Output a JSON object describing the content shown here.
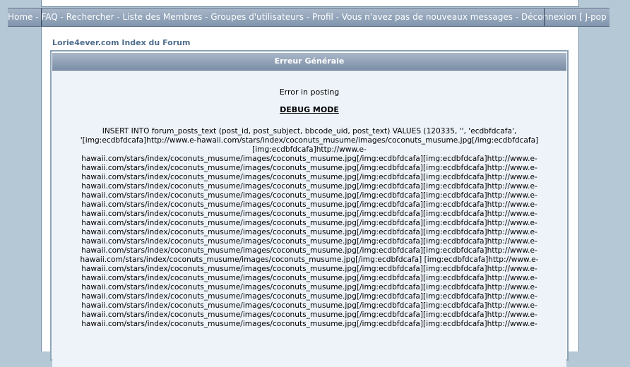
{
  "nav": {
    "items": [
      "Home",
      "FAQ",
      "Rechercher",
      "Liste des Membres",
      "Groupes d'utilisateurs",
      "Profil",
      "Vous n'avez pas de nouveaux messages",
      "Déconnexion [ J-pop idol ]"
    ],
    "separator": "-"
  },
  "forum_index_link": "Lorie4ever.com Index du Forum",
  "error": {
    "title": "Erreur Générale",
    "message": "Error in posting",
    "debug_label": "DEBUG MODE",
    "sql_lines": [
      "INSERT INTO forum_posts_text (post_id, post_subject, bbcode_uid, post_text) VALUES (120335, '', 'ecdbfdcafa',",
      "'[img:ecdbfdcafa]http://www.e-hawaii.com/stars/index/coconuts_musume/images/coconuts_musume.jpg[/img:ecdbfdcafa]",
      "[img:ecdbfdcafa]http://www.e-",
      "hawaii.com/stars/index/coconuts_musume/images/coconuts_musume.jpg[/img:ecdbfdcafa][img:ecdbfdcafa]http://www.e-",
      "hawaii.com/stars/index/coconuts_musume/images/coconuts_musume.jpg[/img:ecdbfdcafa][img:ecdbfdcafa]http://www.e-",
      "hawaii.com/stars/index/coconuts_musume/images/coconuts_musume.jpg[/img:ecdbfdcafa][img:ecdbfdcafa]http://www.e-",
      "hawaii.com/stars/index/coconuts_musume/images/coconuts_musume.jpg[/img:ecdbfdcafa][img:ecdbfdcafa]http://www.e-",
      "hawaii.com/stars/index/coconuts_musume/images/coconuts_musume.jpg[/img:ecdbfdcafa][img:ecdbfdcafa]http://www.e-",
      "hawaii.com/stars/index/coconuts_musume/images/coconuts_musume.jpg[/img:ecdbfdcafa][img:ecdbfdcafa]http://www.e-",
      "hawaii.com/stars/index/coconuts_musume/images/coconuts_musume.jpg[/img:ecdbfdcafa][img:ecdbfdcafa]http://www.e-",
      "hawaii.com/stars/index/coconuts_musume/images/coconuts_musume.jpg[/img:ecdbfdcafa][img:ecdbfdcafa]http://www.e-",
      "hawaii.com/stars/index/coconuts_musume/images/coconuts_musume.jpg[/img:ecdbfdcafa][img:ecdbfdcafa]http://www.e-",
      "hawaii.com/stars/index/coconuts_musume/images/coconuts_musume.jpg[/img:ecdbfdcafa][img:ecdbfdcafa]http://www.e-",
      "hawaii.com/stars/index/coconuts_musume/images/coconuts_musume.jpg[/img:ecdbfdcafa][img:ecdbfdcafa]http://www.e-",
      "hawaii.com/stars/index/coconuts_musume/images/coconuts_musume.jpg[/img:ecdbfdcafa] [img:ecdbfdcafa]http://www.e-",
      "hawaii.com/stars/index/coconuts_musume/images/coconuts_musume.jpg[/img:ecdbfdcafa][img:ecdbfdcafa]http://www.e-",
      "hawaii.com/stars/index/coconuts_musume/images/coconuts_musume.jpg[/img:ecdbfdcafa][img:ecdbfdcafa]http://www.e-",
      "hawaii.com/stars/index/coconuts_musume/images/coconuts_musume.jpg[/img:ecdbfdcafa][img:ecdbfdcafa]http://www.e-",
      "hawaii.com/stars/index/coconuts_musume/images/coconuts_musume.jpg[/img:ecdbfdcafa][img:ecdbfdcafa]http://www.e-",
      "hawaii.com/stars/index/coconuts_musume/images/coconuts_musume.jpg[/img:ecdbfdcafa][img:ecdbfdcafa]http://www.e-",
      "hawaii.com/stars/index/coconuts_musume/images/coconuts_musume.jpg[/img:ecdbfdcafa][img:ecdbfdcafa]http://www.e-",
      "hawaii.com/stars/index/coconuts_musume/images/coconuts_musume.jpg[/img:ecdbfdcafa][img:ecdbfdcafa]http://www.e-"
    ]
  }
}
